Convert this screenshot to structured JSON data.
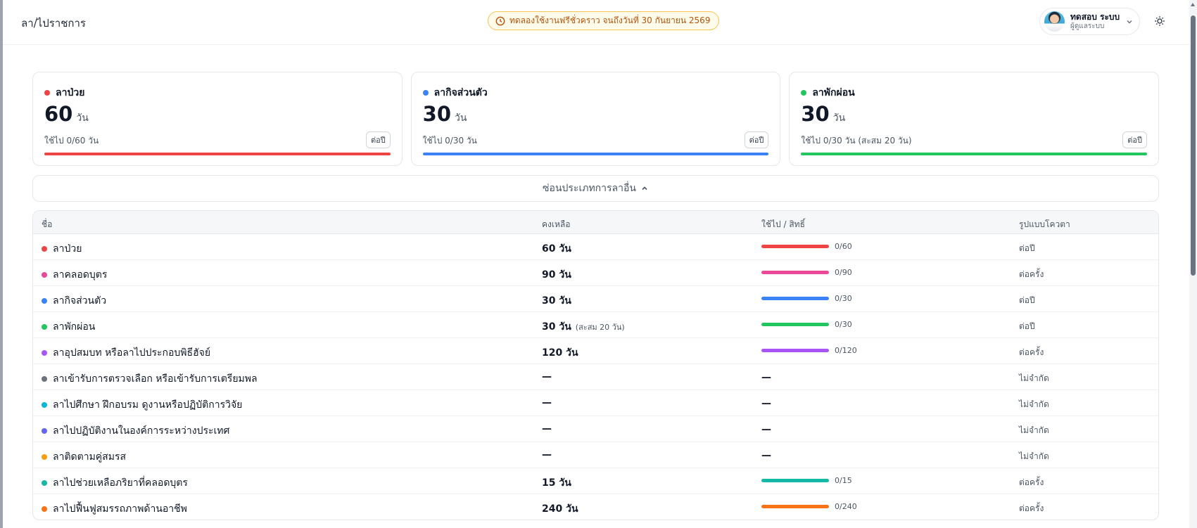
{
  "header": {
    "title": "ลา/ไปราชการ",
    "trial_text": "ทดลองใช้งานฟรีชั่วคราว จนถึงวันที่ 30 กันยายน 2569",
    "user_name": "ทดสอบ ระบบ",
    "user_role": "ผู้ดูแลระบบ"
  },
  "cards": [
    {
      "name": "ลาป่วย",
      "value": "60",
      "unit": "วัน",
      "used": "ใช้ไป 0/60 วัน",
      "quota": "ต่อปี",
      "color": "#ef4444"
    },
    {
      "name": "ลากิจส่วนตัว",
      "value": "30",
      "unit": "วัน",
      "used": "ใช้ไป 0/30 วัน",
      "quota": "ต่อปี",
      "color": "#3b82f6"
    },
    {
      "name": "ลาพักผ่อน",
      "value": "30",
      "unit": "วัน",
      "used": "ใช้ไป 0/30 วัน (สะสม 20 วัน)",
      "quota": "ต่อปี",
      "color": "#22c55e"
    }
  ],
  "toggle_label": "ซ่อนประเภทการลาอื่น",
  "table": {
    "headers": {
      "name": "ชื่อ",
      "remaining": "คงเหลือ",
      "usage": "ใช้ไป / สิทธิ์",
      "quota": "รูปแบบโควตา"
    },
    "rows": [
      {
        "name": "ลาป่วย",
        "color": "#ef4444",
        "remaining": "60 วัน",
        "note": "",
        "usage": "0/60",
        "has_bar": true,
        "quota": "ต่อปี"
      },
      {
        "name": "ลาคลอดบุตร",
        "color": "#ec4899",
        "remaining": "90 วัน",
        "note": "",
        "usage": "0/90",
        "has_bar": true,
        "quota": "ต่อครั้ง"
      },
      {
        "name": "ลากิจส่วนตัว",
        "color": "#3b82f6",
        "remaining": "30 วัน",
        "note": "",
        "usage": "0/30",
        "has_bar": true,
        "quota": "ต่อปี"
      },
      {
        "name": "ลาพักผ่อน",
        "color": "#22c55e",
        "remaining": "30 วัน",
        "note": "(สะสม 20 วัน)",
        "usage": "0/30",
        "has_bar": true,
        "quota": "ต่อปี"
      },
      {
        "name": "ลาอุปสมบท หรือลาไปประกอบพิธีฮัจย์",
        "color": "#a855f7",
        "remaining": "120 วัน",
        "note": "",
        "usage": "0/120",
        "has_bar": true,
        "quota": "ต่อครั้ง"
      },
      {
        "name": "ลาเข้ารับการตรวจเลือก หรือเข้ารับการเตรียมพล",
        "color": "#6b7280",
        "remaining": "—",
        "note": "",
        "usage": "—",
        "has_bar": false,
        "quota": "ไม่จำกัด"
      },
      {
        "name": "ลาไปศึกษา ฝึกอบรม ดูงานหรือปฏิบัติการวิจัย",
        "color": "#06b6d4",
        "remaining": "—",
        "note": "",
        "usage": "—",
        "has_bar": false,
        "quota": "ไม่จำกัด"
      },
      {
        "name": "ลาไปปฏิบัติงานในองค์การระหว่างประเทศ",
        "color": "#6366f1",
        "remaining": "—",
        "note": "",
        "usage": "—",
        "has_bar": false,
        "quota": "ไม่จำกัด"
      },
      {
        "name": "ลาติดตามคู่สมรส",
        "color": "#f59e0b",
        "remaining": "—",
        "note": "",
        "usage": "—",
        "has_bar": false,
        "quota": "ไม่จำกัด"
      },
      {
        "name": "ลาไปช่วยเหลือภริยาที่คลอดบุตร",
        "color": "#14b8a6",
        "remaining": "15 วัน",
        "note": "",
        "usage": "0/15",
        "has_bar": true,
        "quota": "ต่อครั้ง"
      },
      {
        "name": "ลาไปฟื้นฟูสมรรถภาพด้านอาชีพ",
        "color": "#f97316",
        "remaining": "240 วัน",
        "note": "",
        "usage": "0/240",
        "has_bar": true,
        "quota": "ต่อครั้ง"
      }
    ]
  },
  "icons": {
    "clock": "clock-icon",
    "chevron_down": "chevron-down-icon",
    "chevron_up": "chevron-up-icon",
    "theme": "sun-icon"
  }
}
